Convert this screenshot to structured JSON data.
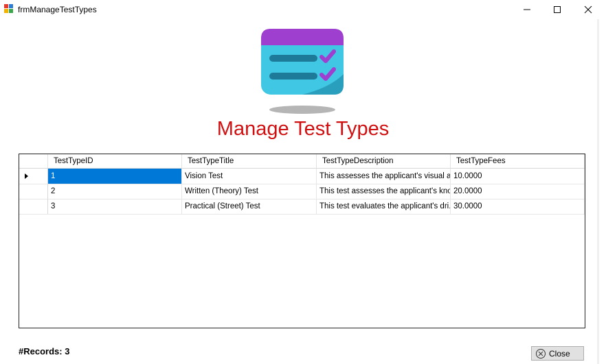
{
  "window": {
    "title": "frmManageTestTypes"
  },
  "page": {
    "heading": "Manage Test Types"
  },
  "grid": {
    "columns": [
      "TestTypeID",
      "TestTypeTitle",
      "TestTypeDescription",
      "TestTypeFees"
    ],
    "rows": [
      {
        "id": "1",
        "title": "Vision Test",
        "description": "This assesses the applicant's visual a...",
        "fees": "10.0000"
      },
      {
        "id": "2",
        "title": "Written (Theory) Test",
        "description": "This test assesses the applicant's kno...",
        "fees": "20.0000"
      },
      {
        "id": "3",
        "title": "Practical (Street) Test",
        "description": "This test evaluates the applicant's dri...",
        "fees": "30.0000"
      }
    ],
    "selected_row": 0
  },
  "footer": {
    "records_label": "#Records: 3",
    "close_label": "Close"
  },
  "colors": {
    "heading": "#d01010",
    "selection": "#0078d7"
  }
}
